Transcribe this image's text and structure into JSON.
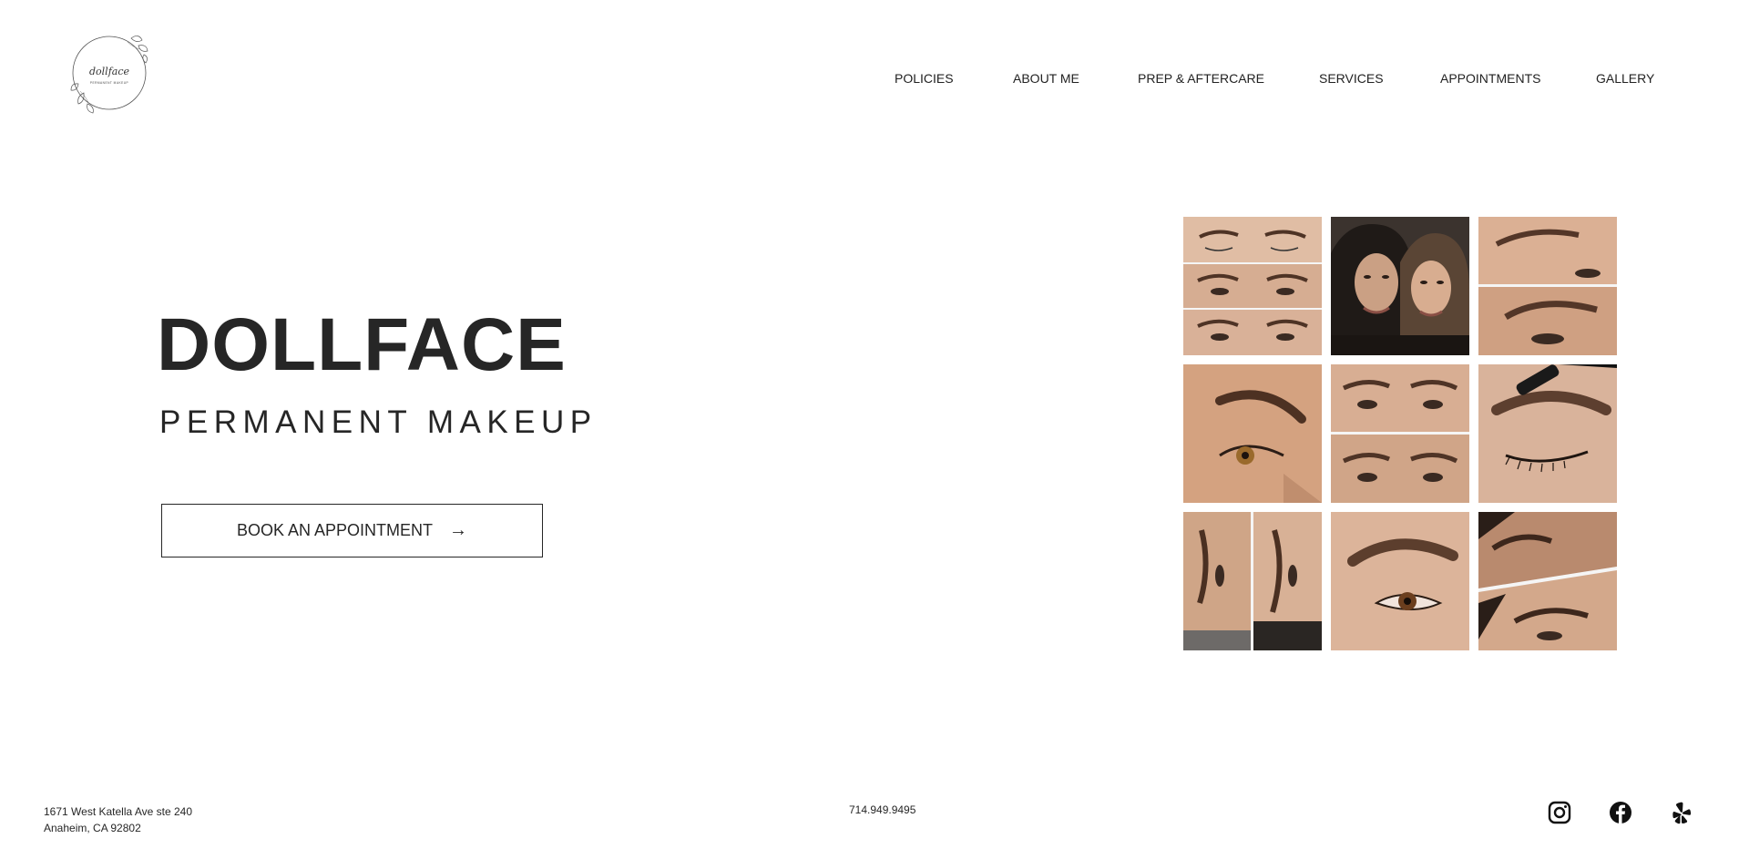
{
  "logo": {
    "text": "dollface",
    "tagline": "PERMANENT MAKEUP"
  },
  "nav": {
    "items": [
      "POLICIES",
      "ABOUT ME",
      "PREP & AFTERCARE",
      "SERVICES",
      "APPOINTMENTS",
      "GALLERY"
    ]
  },
  "hero": {
    "title": "DOLLFACE",
    "subtitle": "PERMANENT MAKEUP",
    "cta_label": "BOOK AN APPOINTMENT",
    "cta_arrow": "→"
  },
  "gallery": {
    "tiles": [
      "brow-before-after-collage",
      "client-selfie-photo",
      "brow-closeup-pair",
      "brow-profile-closeup",
      "brow-front-pair",
      "brow-spoolie-closeup",
      "brow-split-collage",
      "brow-eye-closeup",
      "brow-pair-collage"
    ]
  },
  "footer": {
    "address_line1": "1671 West Katella Ave ste 240",
    "address_line2": "Anaheim, CA 92802",
    "phone": "714.949.9495",
    "social": [
      "instagram-icon",
      "facebook-icon",
      "yelp-icon"
    ]
  },
  "colors": {
    "text": "#262626",
    "background": "#ffffff",
    "skin": "#d9a585",
    "brow": "#5a3b2b"
  }
}
